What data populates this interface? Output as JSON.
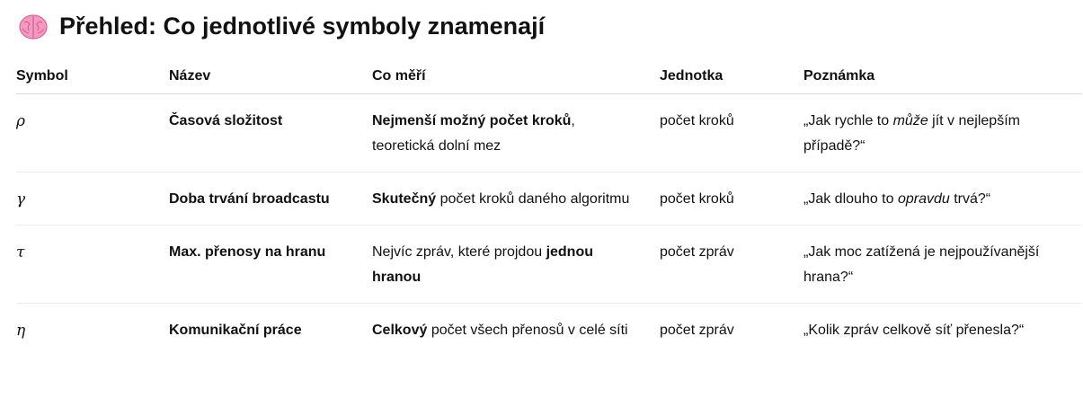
{
  "heading": {
    "icon": "brain-icon",
    "title": "Přehled: Co jednotlivé symboly znamenají"
  },
  "table": {
    "headers": {
      "symbol": "Symbol",
      "name": "Název",
      "measures": "Co měří",
      "unit": "Jednotka",
      "note": "Poznámka"
    },
    "rows": [
      {
        "symbol": "ρ",
        "name": "Časová složitost",
        "measures": {
          "bold": "Nejmenší možný počet kroků",
          "rest": ", teoretická dolní mez"
        },
        "unit": "počet kroků",
        "note": {
          "pre": "„Jak rychle to ",
          "em": "může",
          "post": " jít v nejlepším případě?“"
        }
      },
      {
        "symbol": "γ",
        "name": "Doba trvání broadcastu",
        "measures": {
          "bold": "Skutečný",
          "rest": " počet kroků daného algoritmu"
        },
        "unit": "počet kroků",
        "note": {
          "pre": "„Jak dlouho to ",
          "em": "opravdu",
          "post": " trvá?“"
        }
      },
      {
        "symbol": "τ",
        "name": "Max. přenosy na hranu",
        "measures": {
          "pre": "Nejvíc zpráv, které projdou ",
          "bold": "jednou hranou"
        },
        "unit": "počet zpráv",
        "note": {
          "text": "„Jak moc zatížená je nejpoužívanější hrana?“"
        }
      },
      {
        "symbol": "η",
        "name": "Komunikační práce",
        "measures": {
          "bold": "Celkový",
          "rest": " počet všech přenosů v celé síti"
        },
        "unit": "počet zpráv",
        "note": {
          "text": "„Kolik zpráv celkově síť přenesla?“"
        }
      }
    ]
  }
}
